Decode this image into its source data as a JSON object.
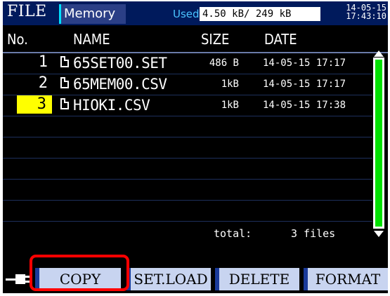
{
  "header": {
    "title": "FILE",
    "tab": "Memory",
    "used_label": "Used",
    "used_value": "4.50 kB/ 249 kB",
    "date": "14-05-15",
    "time": "17:43:10"
  },
  "columns": {
    "no": "No.",
    "name": "NAME",
    "size": "SIZE",
    "date": "DATE"
  },
  "files": [
    {
      "no": "1",
      "name": "65SET00.SET",
      "size": "486 B",
      "date": "14-05-15 17:17"
    },
    {
      "no": "2",
      "name": "65MEM00.CSV",
      "size": "1kB",
      "date": "14-05-15 17:17"
    },
    {
      "no": "3",
      "name": "HIOKI.CSV",
      "size": "1kB",
      "date": "14-05-15 17:38"
    }
  ],
  "selected_file_no": "3",
  "total": {
    "label": "total:",
    "value": "3 files"
  },
  "function_keys": {
    "copy": "COPY",
    "set_load": "SET.LOAD",
    "delete": "DELETE",
    "format": "FORMAT"
  },
  "colors": {
    "selected_row": "#ffff00",
    "scroll_thumb": "#00e000",
    "highlight": "#ff0000",
    "header_bg": "#001a5c"
  },
  "icons": {
    "file": "file-icon",
    "power_plug": "power-plug-icon"
  }
}
